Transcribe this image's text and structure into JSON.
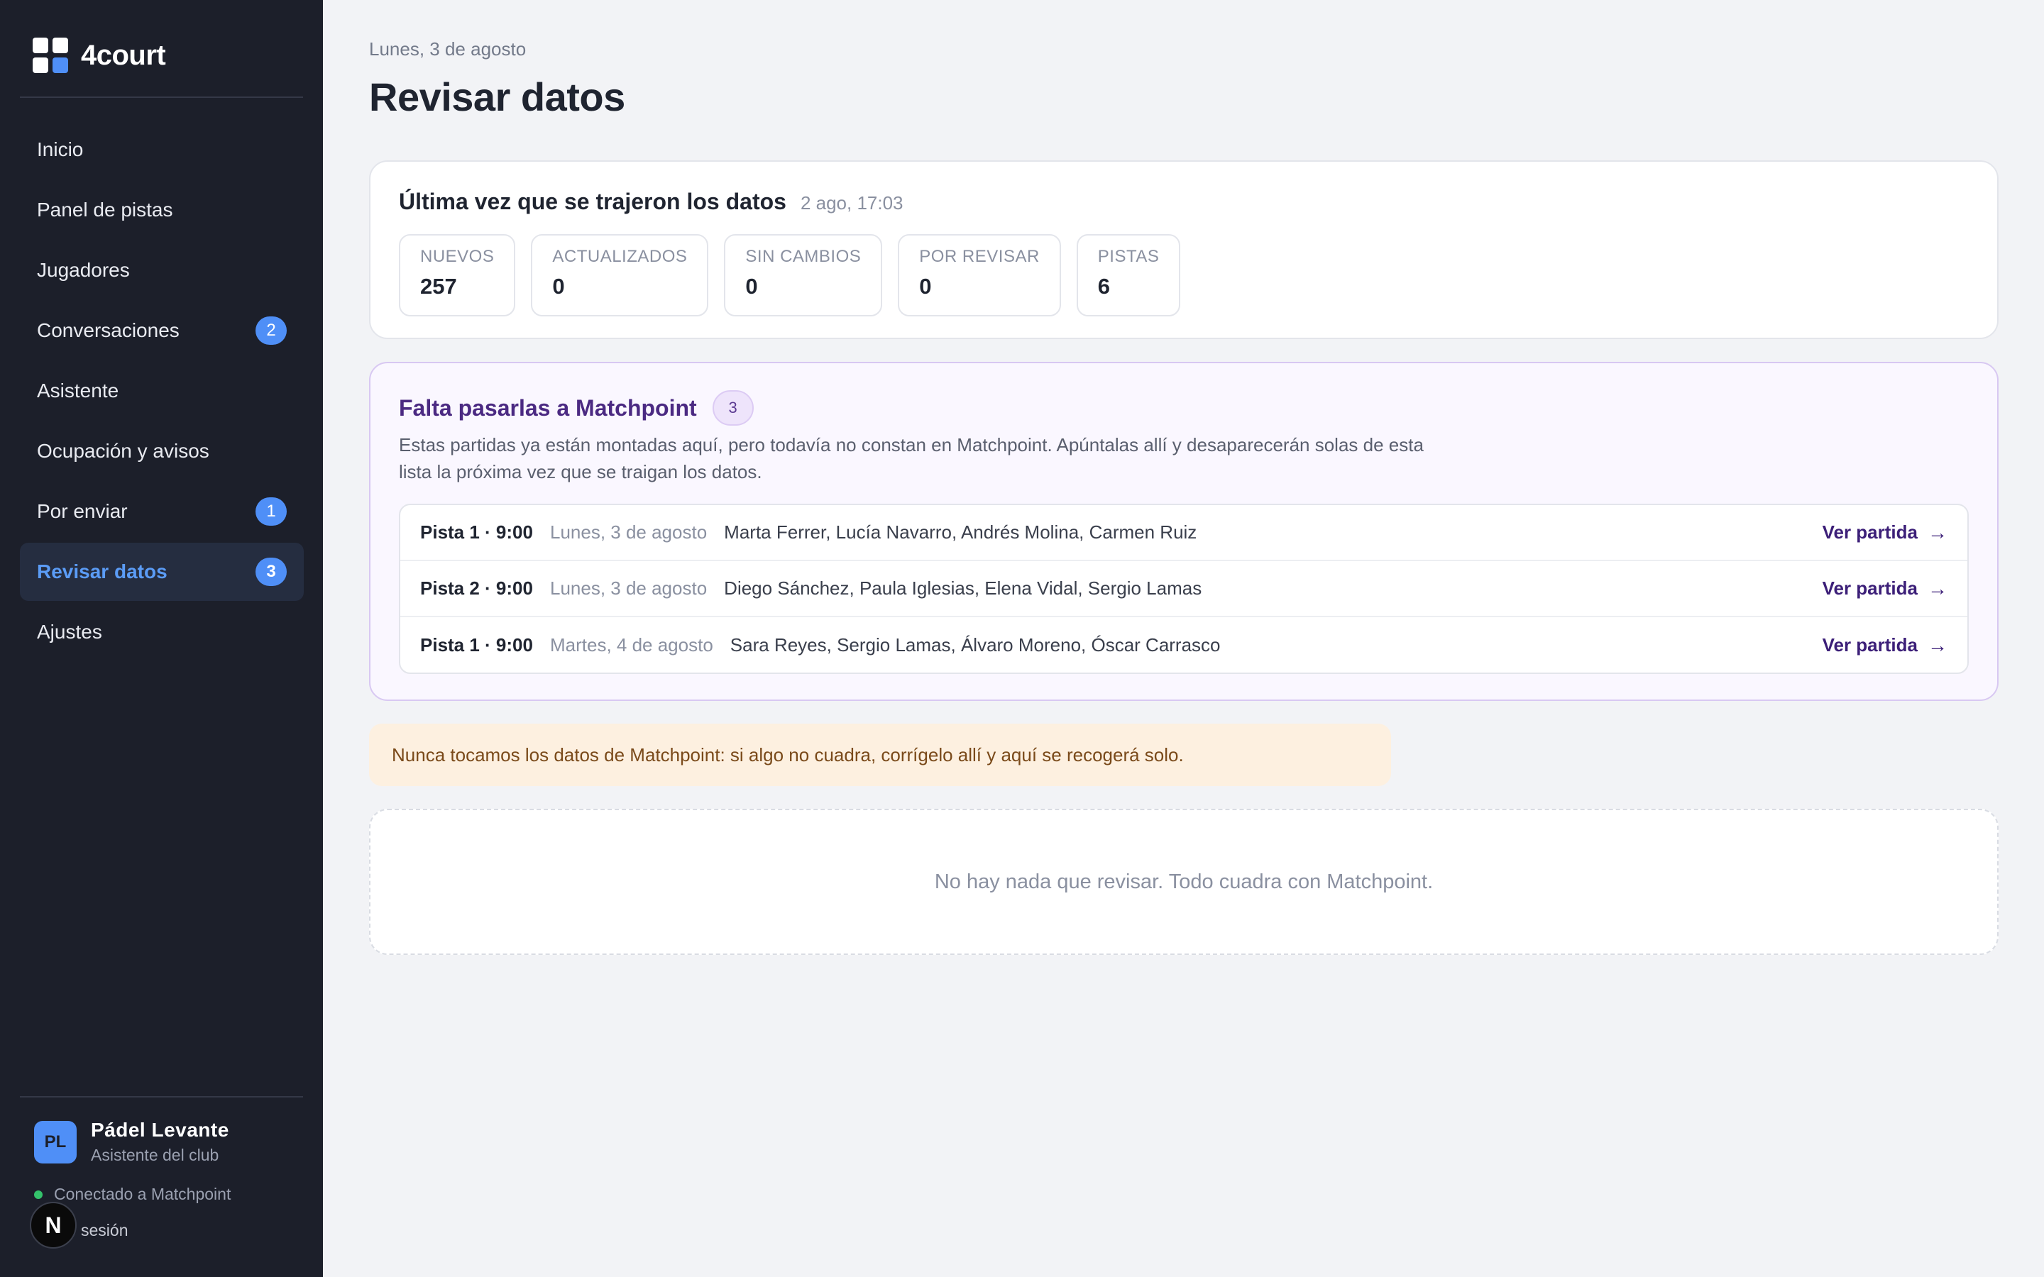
{
  "app": {
    "name": "4court"
  },
  "sidebar": {
    "items": [
      {
        "label": "Inicio"
      },
      {
        "label": "Panel de pistas"
      },
      {
        "label": "Jugadores"
      },
      {
        "label": "Conversaciones",
        "badge": "2"
      },
      {
        "label": "Asistente"
      },
      {
        "label": "Ocupación y avisos"
      },
      {
        "label": "Por enviar",
        "badge": "1"
      },
      {
        "label": "Revisar datos",
        "badge": "3",
        "active": true
      },
      {
        "label": "Ajustes"
      }
    ],
    "user": {
      "initials": "PL",
      "name": "Pádel Levante",
      "role": "Asistente del club",
      "connection": "Conectado a Matchpoint",
      "logout": "sesión"
    },
    "n_badge": "N"
  },
  "header": {
    "date": "Lunes, 3 de agosto",
    "title": "Revisar datos"
  },
  "sync": {
    "title": "Última vez que se trajeron los datos",
    "time": "2 ago, 17:03",
    "stats": [
      {
        "label": "NUEVOS",
        "value": "257"
      },
      {
        "label": "ACTUALIZADOS",
        "value": "0"
      },
      {
        "label": "SIN CAMBIOS",
        "value": "0"
      },
      {
        "label": "POR REVISAR",
        "value": "0"
      },
      {
        "label": "PISTAS",
        "value": "6"
      }
    ]
  },
  "pending": {
    "title": "Falta pasarlas a Matchpoint",
    "count": "3",
    "description": "Estas partidas ya están montadas aquí, pero todavía no constan en Matchpoint. Apúntalas allí y desaparecerán solas de esta lista la próxima vez que se traigan los datos.",
    "link_label": "Ver partida",
    "matches": [
      {
        "court": "Pista 1 · 9:00",
        "date": "Lunes, 3 de agosto",
        "players": "Marta Ferrer, Lucía Navarro, Andrés Molina, Carmen Ruiz"
      },
      {
        "court": "Pista 2 · 9:00",
        "date": "Lunes, 3 de agosto",
        "players": "Diego Sánchez, Paula Iglesias, Elena Vidal, Sergio Lamas"
      },
      {
        "court": "Pista 1 · 9:00",
        "date": "Martes, 4 de agosto",
        "players": "Sara Reyes, Sergio Lamas, Álvaro Moreno, Óscar Carrasco"
      }
    ]
  },
  "notice": "Nunca tocamos los datos de Matchpoint: si algo no cuadra, corrígelo allí y aquí se recogerá solo.",
  "empty_state": "No hay nada que revisar. Todo cuadra con Matchpoint.",
  "colors": {
    "sidebar_bg": "#1c1f2a",
    "accent": "#4f8ff7",
    "purple": "#4b2a82",
    "notice_bg": "#fdf0e0"
  }
}
